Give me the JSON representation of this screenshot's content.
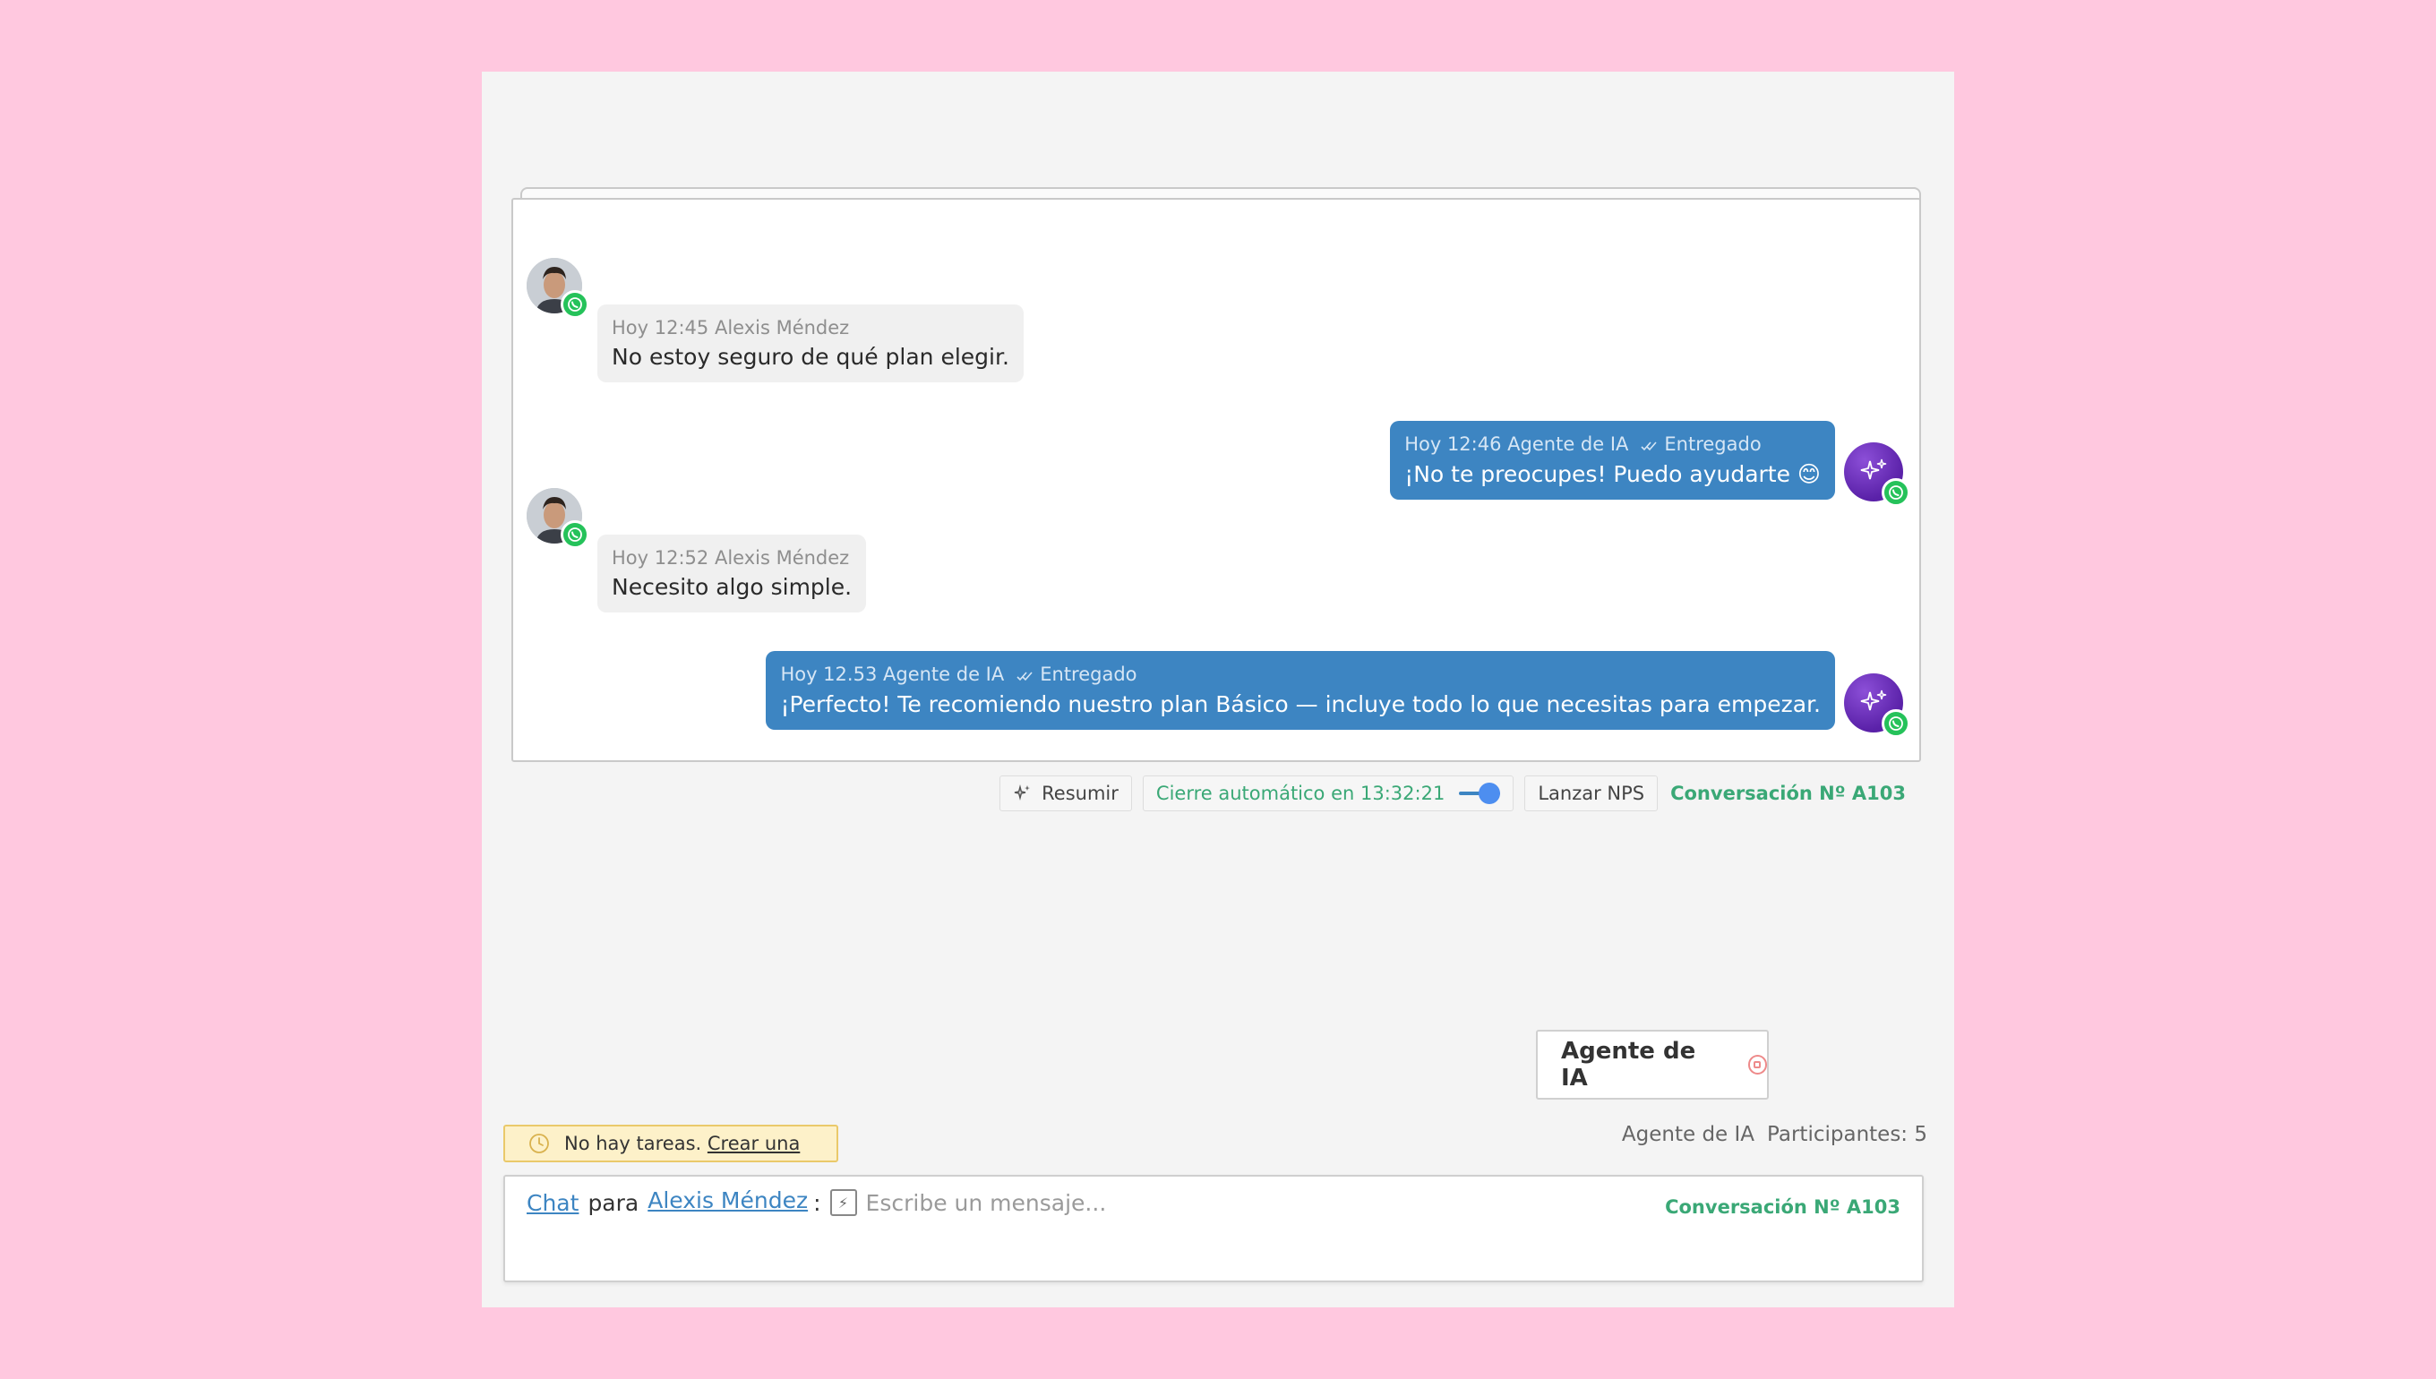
{
  "messages": [
    {
      "time": "Hoy 12:45",
      "author": "Alexis Méndez",
      "text": "No estoy seguro de qué plan elegir.",
      "direction": "in"
    },
    {
      "time": "Hoy 12:46",
      "author": "Agente de IA",
      "status": "Entregado",
      "text": "¡No te preocupes! Puedo ayudarte 😊",
      "direction": "out"
    },
    {
      "time": "Hoy 12:52",
      "author": "Alexis Méndez",
      "text": "Necesito algo simple.",
      "direction": "in"
    },
    {
      "time": "Hoy 12.53",
      "author": "Agente de IA",
      "status": "Entregado",
      "text": "¡Perfecto! Te recomiendo nuestro plan Básico — incluye todo lo que necesitas para empezar.",
      "direction": "out"
    }
  ],
  "toolbar": {
    "summarize_label": "Resumir",
    "auto_close_label": "Cierre automático en 13:32:21",
    "nps_label": "Lanzar NPS",
    "conversation_id": "Conversación Nº A103"
  },
  "agent_chip": {
    "label": "Agente de IA"
  },
  "participants": {
    "agent": "Agente de IA",
    "count_label": "Participantes: 5"
  },
  "tasks": {
    "text": "No hay tareas.",
    "link": "Crear una"
  },
  "composer": {
    "channel": "Chat",
    "para": "para",
    "recipient": "Alexis Méndez",
    "colon": ":",
    "placeholder": "Escribe un mensaje...",
    "conversation_id": "Conversación Nº A103"
  },
  "colors": {
    "background": "#ffc8df",
    "outgoing_bubble": "#3d85c2",
    "accent_green": "#3aa876",
    "whatsapp": "#25c25a"
  }
}
